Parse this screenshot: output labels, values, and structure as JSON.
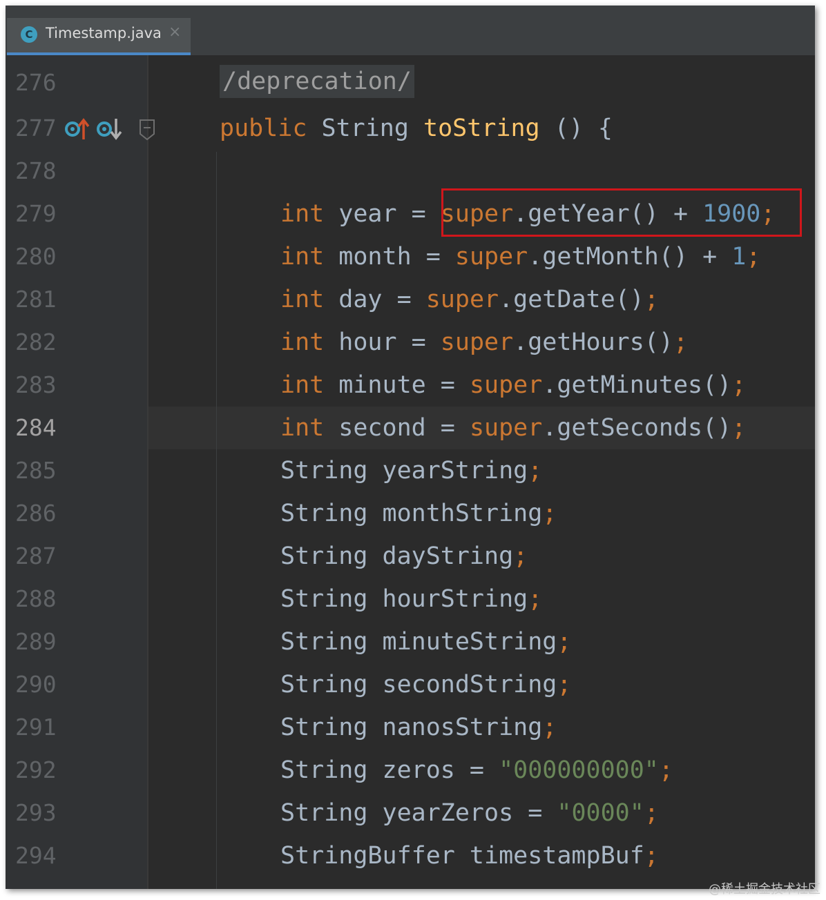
{
  "tab": {
    "label": "Timestamp.java",
    "icon": "class-c-icon",
    "icon_letter": "C",
    "close": "×"
  },
  "line_numbers": [
    "276",
    "277",
    "278",
    "279",
    "280",
    "281",
    "282",
    "283",
    "284",
    "285",
    "286",
    "287",
    "288",
    "289",
    "290",
    "291",
    "292",
    "293",
    "294"
  ],
  "current_line": "284",
  "gutter_icons": [
    "override-up-icon",
    "override-down-icon",
    "fold-marker-icon"
  ],
  "code": {
    "annotation": "/deprecation/",
    "signature": {
      "mod": "public",
      "type": "String",
      "name": "toString",
      "rest": " () {"
    },
    "l279": {
      "kw": "int",
      "var": " year = ",
      "sup": "super",
      "call": ".getYear() + ",
      "num": "1900",
      "semi": ";"
    },
    "l280": {
      "kw": "int",
      "var": " month = ",
      "sup": "super",
      "call": ".getMonth() + ",
      "num": "1",
      "semi": ";"
    },
    "l281": {
      "kw": "int",
      "var": " day = ",
      "sup": "super",
      "call": ".getDate()",
      "semi": ";"
    },
    "l282": {
      "kw": "int",
      "var": " hour = ",
      "sup": "super",
      "call": ".getHours()",
      "semi": ";"
    },
    "l283": {
      "kw": "int",
      "var": " minute = ",
      "sup": "super",
      "call": ".getMinutes()",
      "semi": ";"
    },
    "l284": {
      "kw": "int",
      "var": " second = ",
      "sup": "super",
      "call": ".getSeconds()",
      "semi": ";"
    },
    "l285": {
      "text": "String yearString",
      "semi": ";"
    },
    "l286": {
      "text": "String monthString",
      "semi": ";"
    },
    "l287": {
      "text": "String dayString",
      "semi": ";"
    },
    "l288": {
      "text": "String hourString",
      "semi": ";"
    },
    "l289": {
      "text": "String minuteString",
      "semi": ";"
    },
    "l290": {
      "text": "String secondString",
      "semi": ";"
    },
    "l291": {
      "text": "String nanosString",
      "semi": ";"
    },
    "l292": {
      "text": "String zeros = ",
      "str": "\"000000000\"",
      "semi": ";"
    },
    "l293": {
      "text": "String yearZeros = ",
      "str": "\"0000\"",
      "semi": ";"
    },
    "l294": {
      "text": "StringBuffer timestampBuf",
      "semi": ";"
    }
  },
  "watermark": "@稀土掘金技术社区",
  "colors": {
    "background": "#2b2b2b",
    "keyword": "#cc7832",
    "string": "#6a8759",
    "number": "#6897bb",
    "method_decl": "#ffc66d",
    "highlight_box": "#d0161b",
    "tab_underline": "#4a88c7"
  }
}
